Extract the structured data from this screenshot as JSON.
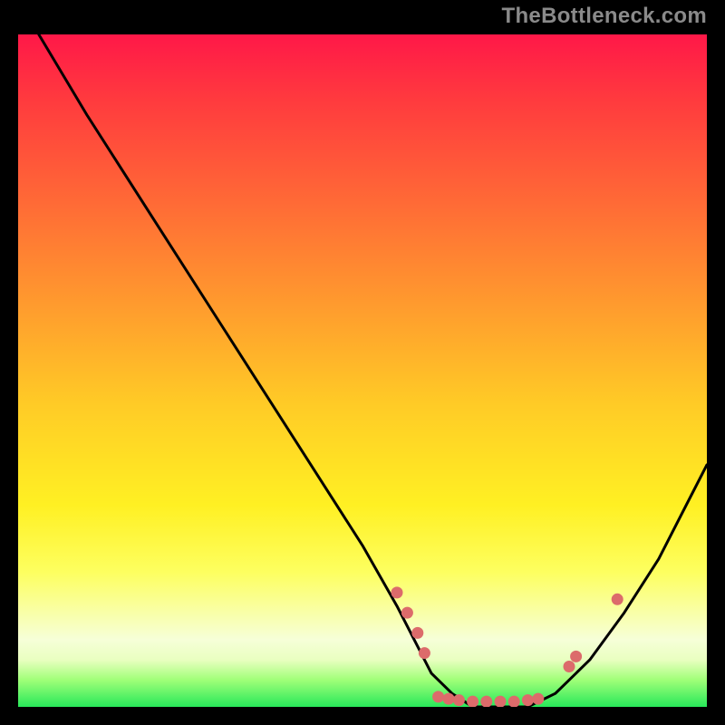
{
  "watermark": "TheBottleneck.com",
  "chart_data": {
    "type": "line",
    "title": "",
    "xlabel": "",
    "ylabel": "",
    "xlim": [
      0,
      100
    ],
    "ylim": [
      0,
      100
    ],
    "series": [
      {
        "name": "bottleneck-curve",
        "x": [
          3,
          10,
          20,
          30,
          40,
          50,
          55,
          58,
          60,
          63,
          66,
          70,
          74,
          78,
          83,
          88,
          93,
          100
        ],
        "y": [
          100,
          88,
          72,
          56,
          40,
          24,
          15,
          9,
          5,
          2,
          0,
          0,
          0,
          2,
          7,
          14,
          22,
          36
        ]
      }
    ],
    "markers": [
      {
        "x": 55,
        "y": 17
      },
      {
        "x": 56.5,
        "y": 14
      },
      {
        "x": 58,
        "y": 11
      },
      {
        "x": 59,
        "y": 8
      },
      {
        "x": 61,
        "y": 1.5
      },
      {
        "x": 62.5,
        "y": 1.2
      },
      {
        "x": 64,
        "y": 1.0
      },
      {
        "x": 66,
        "y": 0.8
      },
      {
        "x": 68,
        "y": 0.8
      },
      {
        "x": 70,
        "y": 0.8
      },
      {
        "x": 72,
        "y": 0.8
      },
      {
        "x": 74,
        "y": 1.0
      },
      {
        "x": 75.5,
        "y": 1.2
      },
      {
        "x": 80,
        "y": 6
      },
      {
        "x": 81,
        "y": 7.5
      },
      {
        "x": 87,
        "y": 16
      }
    ],
    "markerColor": "#dc6b6b",
    "curveColor": "#000000"
  }
}
